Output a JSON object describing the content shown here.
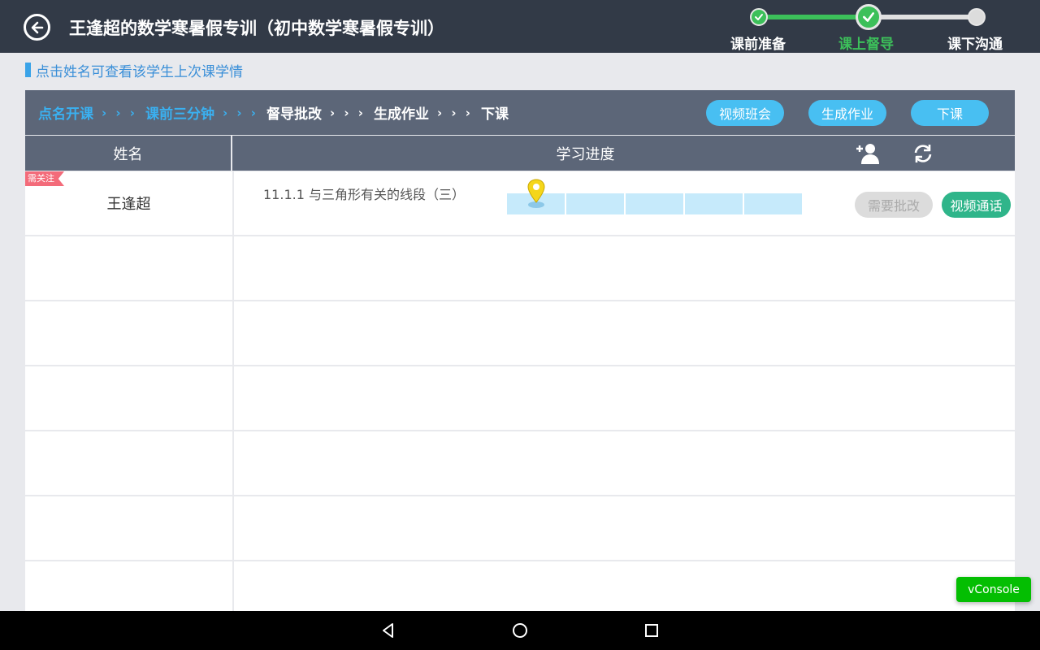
{
  "header": {
    "title": "王逢超的数学寒暑假专训（初中数学寒暑假专训）",
    "steps": [
      {
        "label": "课前准备",
        "state": "done"
      },
      {
        "label": "课上督导",
        "state": "current"
      },
      {
        "label": "课下沟通",
        "state": "todo"
      }
    ]
  },
  "hint": "点击姓名可查看该学生上次课学情",
  "flow": {
    "steps": [
      {
        "label": "点名开课",
        "state": "done"
      },
      {
        "label": "课前三分钟",
        "state": "done"
      },
      {
        "label": "督导批改",
        "state": "todo"
      },
      {
        "label": "生成作业",
        "state": "todo"
      },
      {
        "label": "下课",
        "state": "todo"
      }
    ],
    "arrow": "› › ›",
    "buttons": {
      "video_meeting": "视频班会",
      "generate_homework": "生成作业",
      "end_class": "下课"
    }
  },
  "table": {
    "col_name": "姓名",
    "col_progress": "学习进度",
    "rows": [
      {
        "tag": "需关注",
        "name": "王逢超",
        "lesson": "11.1.1 与三角形有关的线段（三）",
        "progress_segments": 5,
        "review_button": "需要批改",
        "video_button": "视频通话"
      }
    ]
  },
  "vconsole": "vConsole",
  "colors": {
    "topbar": "#323a47",
    "accent_blue": "#48bff2",
    "accent_green": "#3cc05a",
    "tag_pink": "#f36b7a",
    "call_green": "#2fb58a"
  }
}
